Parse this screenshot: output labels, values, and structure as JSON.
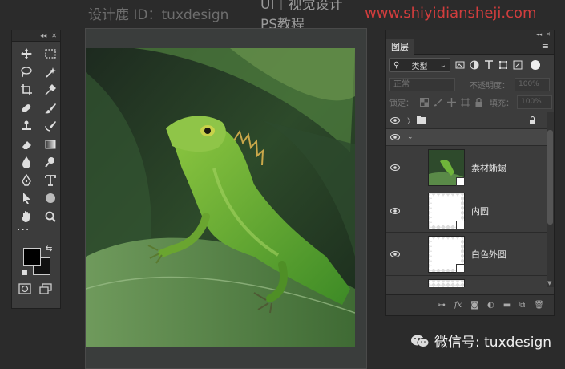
{
  "watermark": {
    "designer": "设计鹿 ID：tuxdesign",
    "channel": "UI｜视觉设计  PS教程",
    "url": "www.shiyidiansheji.com",
    "wechat": "微信号: tuxdesign"
  },
  "tools": {
    "items": [
      "move-tool",
      "marquee-tool",
      "lasso-tool",
      "magic-wand-tool",
      "crop-tool",
      "eyedropper-tool",
      "healing-brush-tool",
      "brush-tool",
      "clone-stamp-tool",
      "history-brush-tool",
      "eraser-tool",
      "gradient-tool",
      "blur-tool",
      "dodge-tool",
      "pen-tool",
      "type-tool",
      "path-selection-tool",
      "ellipse-tool",
      "hand-tool",
      "zoom-tool"
    ],
    "more": "···",
    "foreground_color": "#000000",
    "background_color": "#111111"
  },
  "layers": {
    "tab_label": "图层",
    "filter_label": "类型",
    "blend_mode": "正常",
    "opacity_label": "不透明度：",
    "opacity_value": "100%",
    "lock_label": "锁定：",
    "fill_label": "填充：",
    "fill_value": "100%",
    "items": [
      {
        "name": "素材蜥蜴",
        "type": "image"
      },
      {
        "name": "内圆",
        "type": "shape"
      },
      {
        "name": "白色外圆",
        "type": "shape"
      }
    ]
  },
  "colors": {
    "panel_bg": "#3c3c3c",
    "app_bg": "#2b2b2b",
    "url_red": "#d23d3d",
    "lizard_green": "#5faa2e"
  }
}
